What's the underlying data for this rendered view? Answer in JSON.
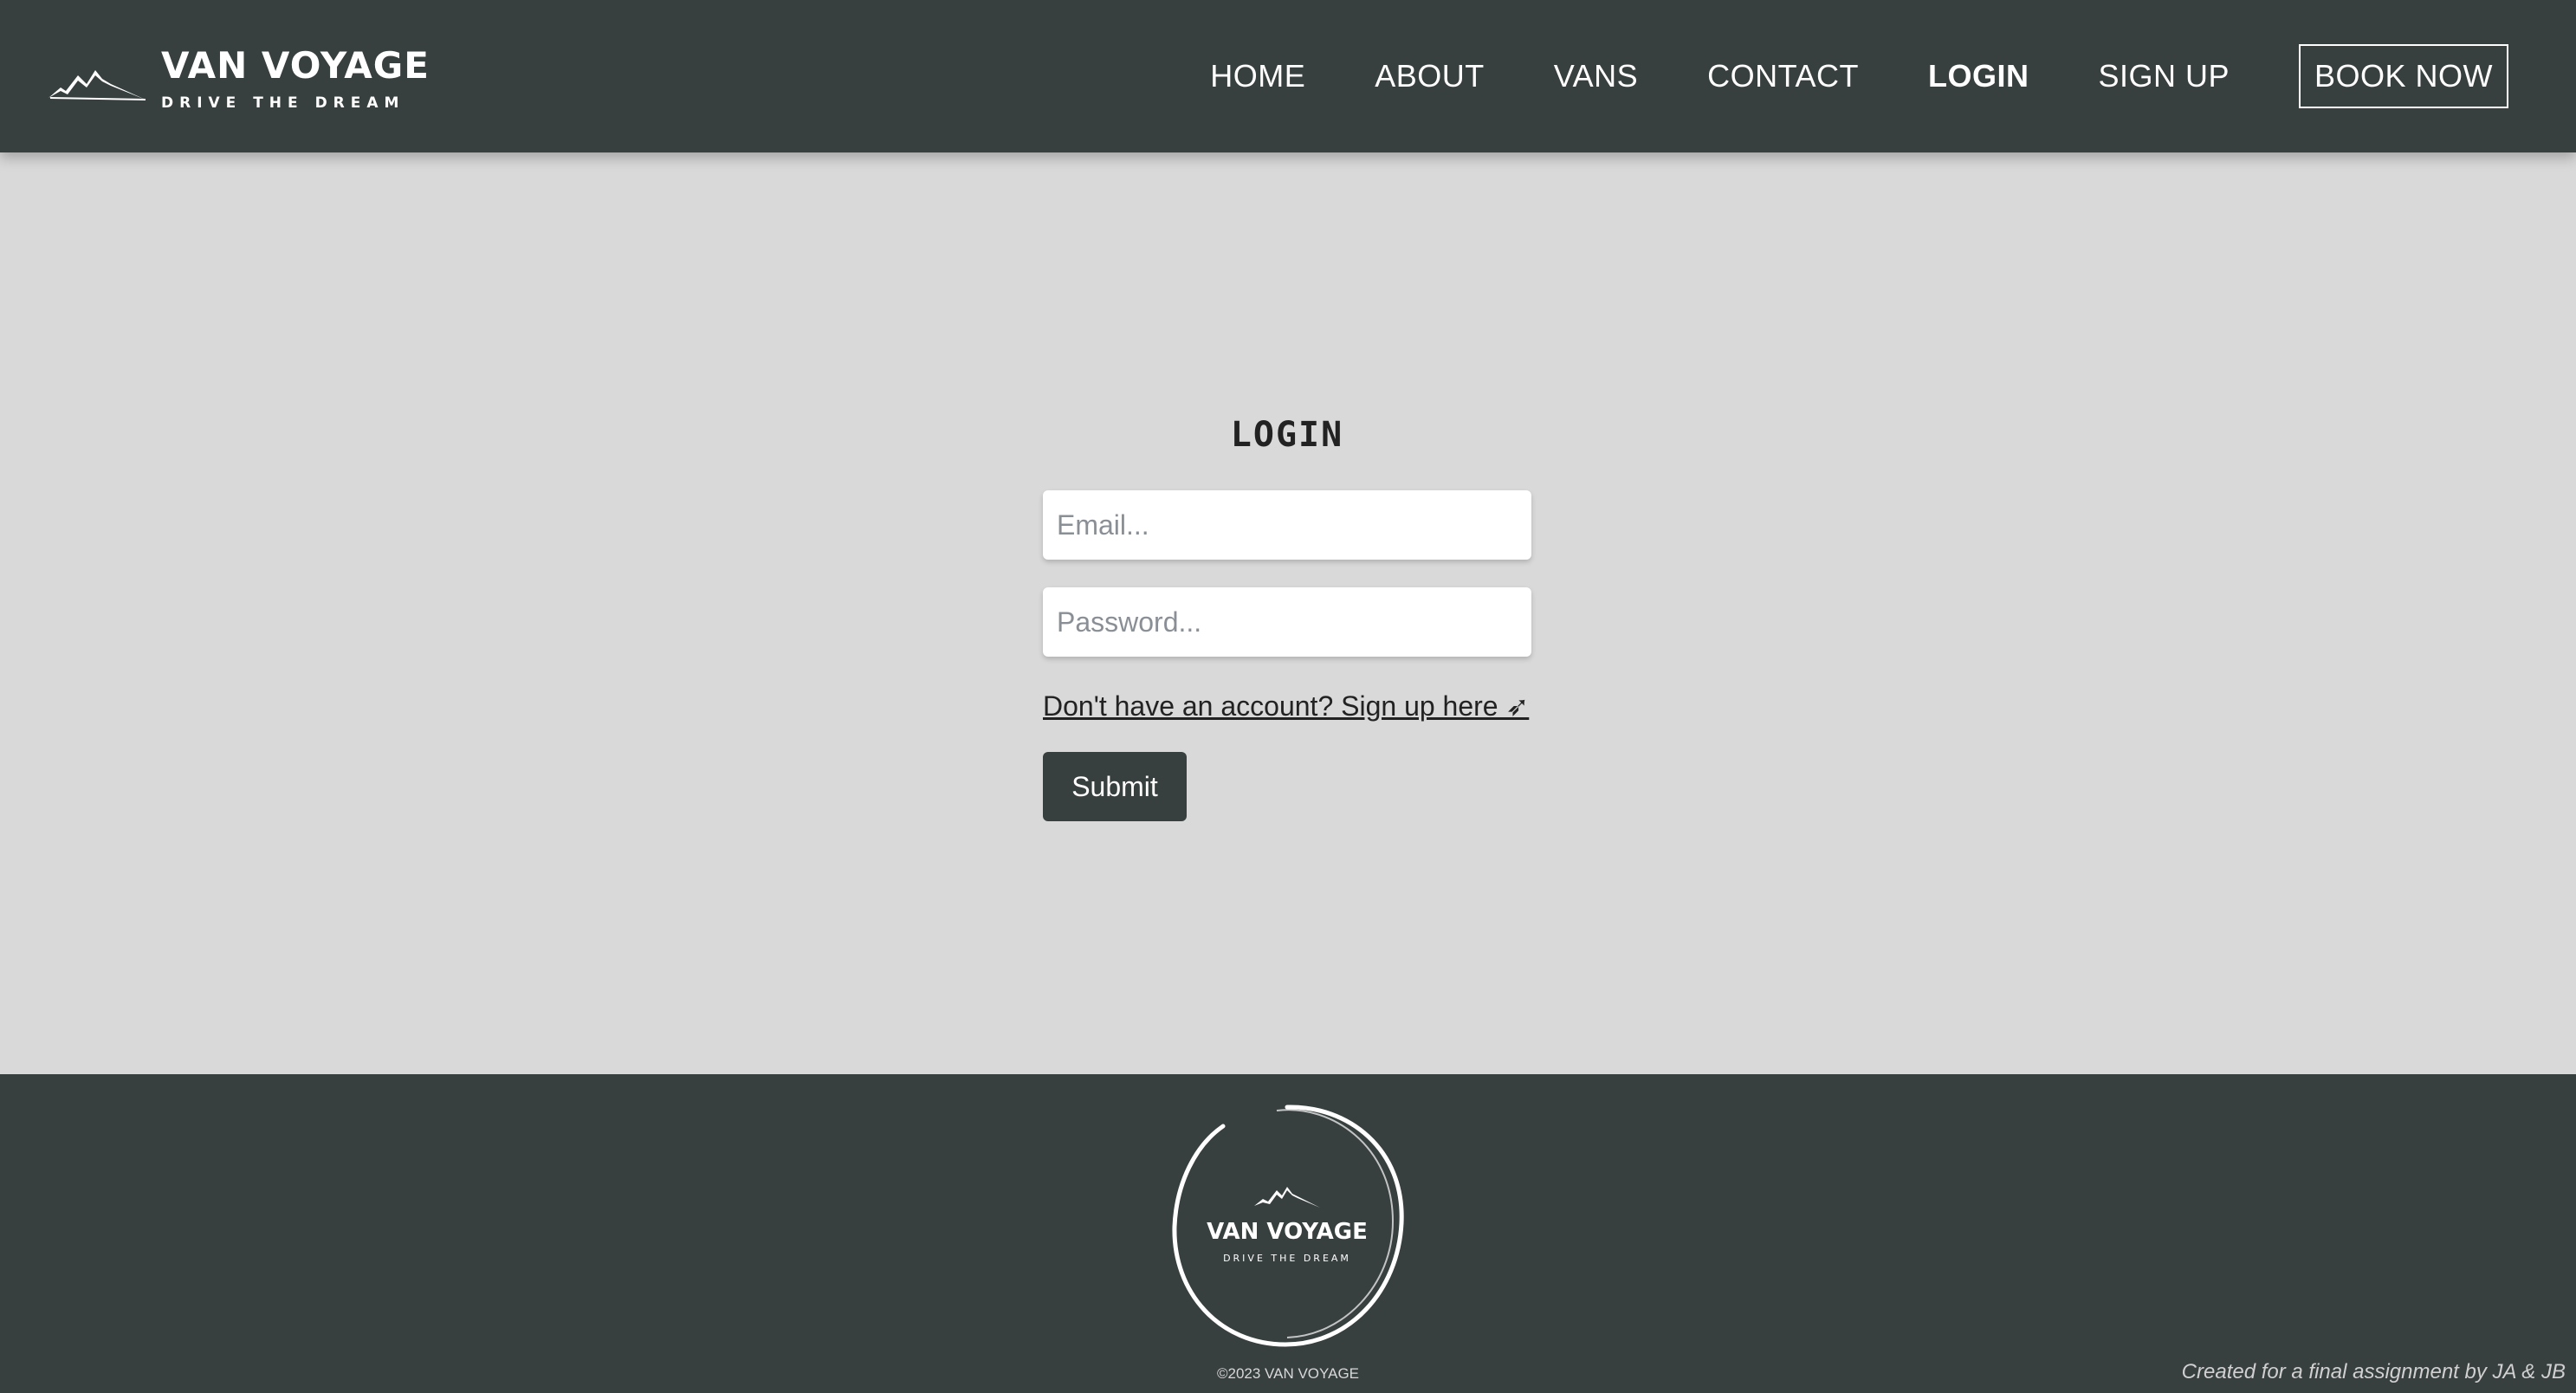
{
  "header": {
    "brand_name": "VAN VOYAGE",
    "brand_tagline": "DRIVE THE DREAM",
    "logo_icon": "mountain-icon",
    "nav": [
      {
        "label": "HOME",
        "active": false
      },
      {
        "label": "ABOUT",
        "active": false
      },
      {
        "label": "VANS",
        "active": false
      },
      {
        "label": "CONTACT",
        "active": false
      },
      {
        "label": "LOGIN",
        "active": true
      },
      {
        "label": "SIGN UP",
        "active": false
      }
    ],
    "cta_label": "BOOK NOW"
  },
  "login": {
    "title": "LOGIN",
    "email_placeholder": "Email...",
    "password_placeholder": "Password...",
    "signup_link": "Don't have an account? Sign up here ➶",
    "submit_label": "Submit"
  },
  "footer": {
    "logo_name": "VAN VOYAGE",
    "logo_tagline": "DRIVE THE DREAM",
    "copyright": "©2023 VAN VOYAGE",
    "credit": "Created for a final assignment by  JA & JB"
  },
  "colors": {
    "header_bg": "#383f3f",
    "page_bg": "#d9d9d9",
    "button_bg": "#383f3f",
    "text_light": "#ffffff"
  }
}
